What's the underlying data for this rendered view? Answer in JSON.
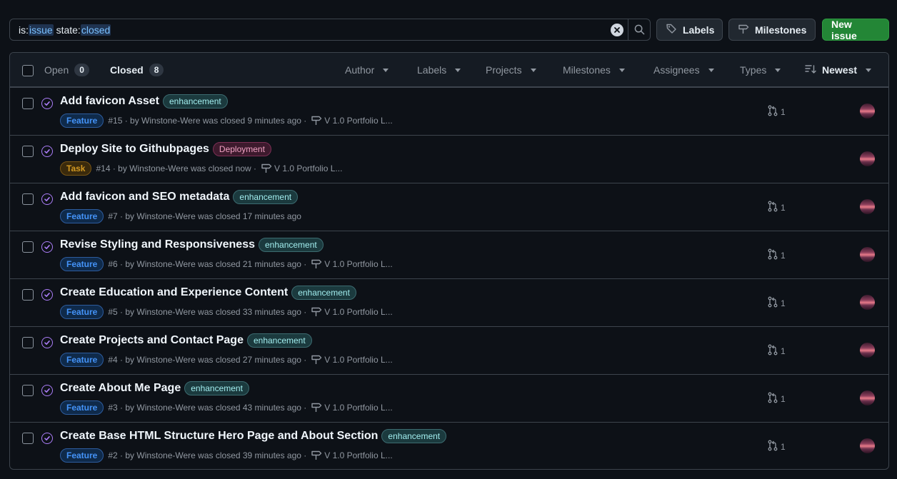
{
  "search": {
    "parts": [
      {
        "text": "is:",
        "kind": "kw"
      },
      {
        "text": "issue",
        "kind": "val"
      },
      {
        "text": " state:",
        "kind": "kw"
      },
      {
        "text": "closed",
        "kind": "val"
      }
    ]
  },
  "toolbar": {
    "labels": "Labels",
    "milestones": "Milestones",
    "new_issue": "New issue"
  },
  "tabs": {
    "open_label": "Open",
    "open_count": "0",
    "closed_label": "Closed",
    "closed_count": "8"
  },
  "filters": [
    "Author",
    "Labels",
    "Projects",
    "Milestones",
    "Assignees",
    "Types"
  ],
  "sort": "Newest",
  "issues": [
    {
      "title": "Add favicon Asset",
      "label": "enhancement",
      "label_kind": "enh",
      "type": "Feature",
      "meta": "#15 · by Winstone-Were was closed 9 minutes ago ·",
      "milestone": "V 1.0 Portfolio L...",
      "pr": "1"
    },
    {
      "title": "Deploy Site to Githubpages",
      "label": "Deployment",
      "label_kind": "dep",
      "type": "Task",
      "meta": "#14 · by Winstone-Were was closed now ·",
      "milestone": "V 1.0 Portfolio L...",
      "pr": ""
    },
    {
      "title": "Add favicon and SEO metadata",
      "label": "enhancement",
      "label_kind": "enh",
      "type": "Feature",
      "meta": "#7 · by Winstone-Were was closed 17 minutes ago",
      "milestone": "",
      "pr": "1"
    },
    {
      "title": "Revise Styling and Responsiveness",
      "label": "enhancement",
      "label_kind": "enh",
      "type": "Feature",
      "meta": "#6 · by Winstone-Were was closed 21 minutes ago ·",
      "milestone": "V 1.0 Portfolio L...",
      "pr": "1"
    },
    {
      "title": "Create Education and Experience Content",
      "label": "enhancement",
      "label_kind": "enh",
      "type": "Feature",
      "meta": "#5 · by Winstone-Were was closed 33 minutes ago ·",
      "milestone": "V 1.0 Portfolio L...",
      "pr": "1"
    },
    {
      "title": "Create Projects and Contact Page",
      "label": "enhancement",
      "label_kind": "enh",
      "type": "Feature",
      "meta": "#4 · by Winstone-Were was closed 27 minutes ago ·",
      "milestone": "V 1.0 Portfolio L...",
      "pr": "1"
    },
    {
      "title": "Create About Me Page",
      "label": "enhancement",
      "label_kind": "enh",
      "type": "Feature",
      "meta": "#3 · by Winstone-Were was closed 43 minutes ago ·",
      "milestone": "V 1.0 Portfolio L...",
      "pr": "1"
    },
    {
      "title": "Create Base HTML Structure Hero Page and About Section",
      "label": "enhancement",
      "label_kind": "enh",
      "type": "Feature",
      "meta": "#2 · by Winstone-Were was closed 39 minutes ago ·",
      "milestone": "V 1.0 Portfolio L...",
      "pr": "1"
    }
  ],
  "icons": {
    "state": "issue-closed-icon",
    "milestone": "milestone-icon",
    "pr": "pull-request-icon",
    "labels": "tag-icon",
    "search": "search-icon",
    "clear": "x-circle-icon",
    "sort": "sort-desc-icon"
  }
}
